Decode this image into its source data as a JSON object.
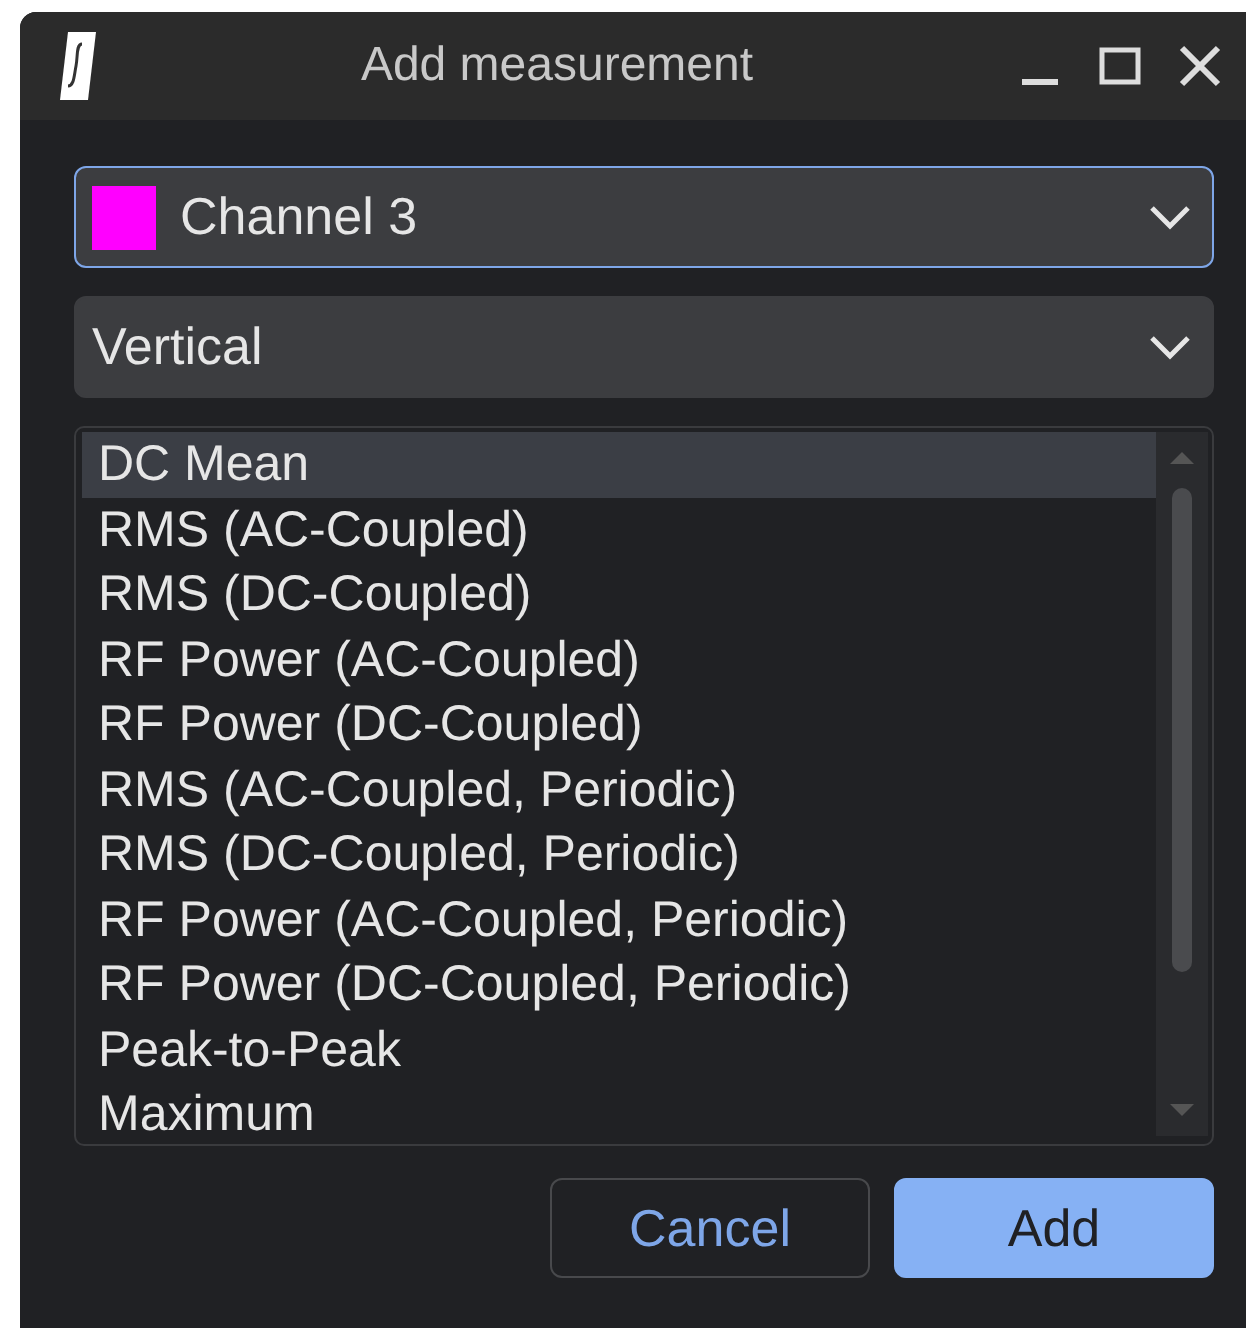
{
  "window": {
    "title": "Add measurement"
  },
  "selects": [
    {
      "label": "Channel 3",
      "color": "#ff00ff",
      "focused": true
    },
    {
      "label": "Vertical",
      "focused": false
    }
  ],
  "measurements": [
    {
      "label": "DC Mean",
      "selected": true
    },
    {
      "label": "RMS (AC-Coupled)",
      "selected": false
    },
    {
      "label": "RMS (DC-Coupled)",
      "selected": false
    },
    {
      "label": "RF Power (AC-Coupled)",
      "selected": false
    },
    {
      "label": "RF Power (DC-Coupled)",
      "selected": false
    },
    {
      "label": "RMS (AC-Coupled, Periodic)",
      "selected": false
    },
    {
      "label": "RMS (DC-Coupled, Periodic)",
      "selected": false
    },
    {
      "label": "RF Power (AC-Coupled, Periodic)",
      "selected": false
    },
    {
      "label": "RF Power (DC-Coupled, Periodic)",
      "selected": false
    },
    {
      "label": "Peak-to-Peak",
      "selected": false
    },
    {
      "label": "Maximum",
      "selected": false
    }
  ],
  "buttons": [
    {
      "label": "Cancel",
      "kind": "secondary"
    },
    {
      "label": "Add",
      "kind": "primary"
    }
  ]
}
